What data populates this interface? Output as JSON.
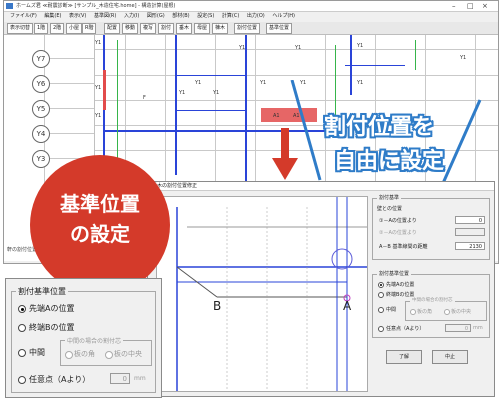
{
  "app": {
    "title": "ホームズ君 ≪耐震診断≫ [サンプル_木造住宅.home] - 構造計算(屋根)",
    "menu": [
      "ファイル(F)",
      "編集(E)",
      "表示(V)",
      "基準図(R)",
      "入力(I)",
      "図形(G)",
      "部材(B)",
      "設定(S)",
      "計算(C)",
      "出力(O)",
      "ヘルプ(H)"
    ],
    "toolbar": [
      "表示切替",
      "1階",
      "2階",
      "小屋",
      "R階",
      "配置",
      "移動",
      "複写",
      "割付",
      "垂木",
      "母屋",
      "棟木",
      "割付位置",
      "基準位置"
    ],
    "axis_labels": [
      "Y7",
      "Y6",
      "Y5",
      "Y4",
      "Y3"
    ],
    "status_left": "軒の割付位置を指定"
  },
  "canvas_labels": [
    "Y1",
    "Y1",
    "Y1",
    "Y1",
    "Y1",
    "Y1",
    "Y1",
    "Y1",
    "Y1",
    "Y1",
    "F",
    "Y1",
    "Y1",
    "A1",
    "A1",
    "Y1"
  ],
  "callouts": {
    "right_line1": "割付位置を",
    "right_line2": "自由に設定",
    "bubble_line1": "基準位置",
    "bubble_line2": "の設定"
  },
  "dialog": {
    "title": "垂木の割付位置修正",
    "preview": {
      "label_b": "B",
      "label_a": "A"
    },
    "group1": {
      "legend": "割付基準",
      "sub": "壁との位置",
      "row1_label": "①－Aの位置より",
      "row1_value": "0",
      "row2_label": "②－Aの位置より",
      "row2_value": "",
      "row3_label": "A－B 基準線間の距離",
      "row3_value": "2130"
    },
    "group2": {
      "legend": "割付基準位置",
      "opt1": "先端Aの位置",
      "opt2": "終端Bの位置",
      "opt3": "中間",
      "mid_legend": "中間の場合の割付芯",
      "mid_opt1": "板の角",
      "mid_opt2": "板の中央",
      "opt4": "任意点（Aより）",
      "opt4_value": "0",
      "unit": "mm"
    },
    "ok": "了解",
    "cancel": "中止"
  },
  "zoom": {
    "legend": "割付基準位置",
    "opt1": "先端Aの位置",
    "opt2": "終端Bの位置",
    "opt3": "中間",
    "mid_legend": "中間の場合の割付芯",
    "mid_opt1": "板の角",
    "mid_opt2": "板の中央",
    "opt4": "任意点（Aより）",
    "opt4_value": "0",
    "unit": "mm"
  },
  "colors": {
    "accent_red": "#d43a2a",
    "callout_blue": "#2f7cc8",
    "line_blue": "#2a44d8",
    "line_green": "#36b54a"
  }
}
